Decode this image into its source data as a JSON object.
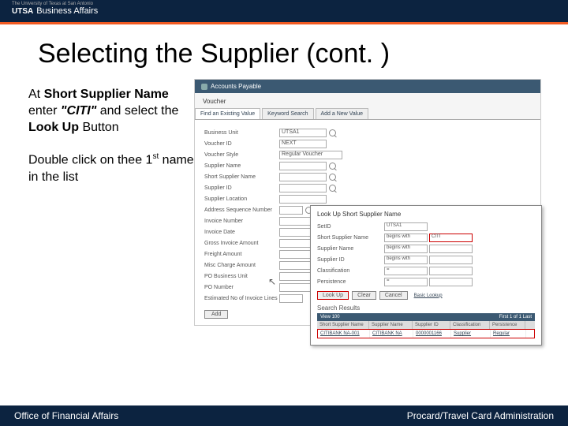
{
  "header": {
    "tagline": "The University of Texas at San Antonio",
    "brand": "UTSA",
    "brand_sub": "Business Affairs"
  },
  "title": "Selecting the Supplier (cont. )",
  "instructions": {
    "p1_pre": "At ",
    "p1_b1": "Short Supplier Name",
    "p1_mid": " enter ",
    "p1_i": "\"CITI\"",
    "p1_mid2": " and select the ",
    "p1_b2": "Look Up",
    "p1_post": " Button",
    "p2_pre": "Double click on thee 1",
    "p2_sup": "st",
    "p2_post": " name in the list"
  },
  "ap": {
    "app": "Accounts Payable",
    "section": "Voucher",
    "tabs": [
      "Find an Existing Value",
      "Keyword Search",
      "Add a New Value"
    ],
    "fields": {
      "bu": {
        "label": "Business Unit",
        "value": "UTSA1"
      },
      "vid": {
        "label": "Voucher ID",
        "value": "NEXT"
      },
      "vstyle": {
        "label": "Voucher Style",
        "value": "Regular Voucher"
      },
      "sname": {
        "label": "Supplier Name",
        "value": ""
      },
      "ssname": {
        "label": "Short Supplier Name",
        "value": ""
      },
      "sid": {
        "label": "Supplier ID",
        "value": ""
      },
      "sloc": {
        "label": "Supplier Location",
        "value": ""
      },
      "addr": {
        "label": "Address Sequence Number",
        "value": ""
      },
      "inv": {
        "label": "Invoice Number",
        "value": ""
      },
      "idate": {
        "label": "Invoice Date",
        "value": ""
      },
      "gross": {
        "label": "Gross Invoice Amount",
        "value": ""
      },
      "freight": {
        "label": "Freight Amount",
        "value": ""
      },
      "misc": {
        "label": "Misc Charge Amount",
        "value": ""
      },
      "pobu": {
        "label": "PO Business Unit",
        "value": ""
      },
      "ponum": {
        "label": "PO Number",
        "value": ""
      },
      "estlines": {
        "label": "Estimated No of Invoice Lines",
        "value": ""
      }
    },
    "add": "Add"
  },
  "popup": {
    "title": "Look Up Short Supplier Name",
    "setid": {
      "label": "SetID",
      "value": "UTSA1"
    },
    "ssn": {
      "label": "Short Supplier Name",
      "op": "begins with",
      "value": "CITI"
    },
    "sn": {
      "label": "Supplier Name",
      "op": "begins with",
      "value": ""
    },
    "sid": {
      "label": "Supplier ID",
      "op": "begins with",
      "value": ""
    },
    "cls": {
      "label": "Classification",
      "op": "=",
      "value": ""
    },
    "per": {
      "label": "Persistence",
      "op": "=",
      "value": ""
    },
    "btns": {
      "lookup": "Look Up",
      "clear": "Clear",
      "cancel": "Cancel",
      "basic": "Basic Lookup"
    },
    "results": {
      "header": "Search Results",
      "view": "View 100",
      "nav": "First   1 of 1   Last",
      "cols": [
        "Short Supplier Name",
        "Supplier Name",
        "Supplier ID",
        "Classification",
        "Persistence"
      ],
      "row": [
        "CITIBANK NA-001",
        "CITIBANK NA",
        "0000001166",
        "Supplier",
        "Regular"
      ]
    }
  },
  "footer": {
    "left": "Office of Financial Affairs",
    "right": "Procard/Travel Card Administration"
  }
}
